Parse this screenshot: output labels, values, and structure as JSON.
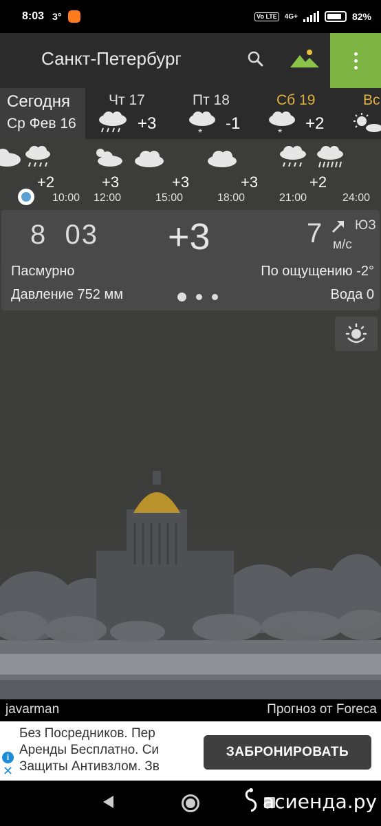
{
  "status_bar": {
    "time": "8:03",
    "temp": "3°",
    "network": "4G+",
    "volte": "Vo LTE",
    "battery": "82%"
  },
  "app_bar": {
    "city": "Санкт-Петербург"
  },
  "days": {
    "today": {
      "label": "Сегодня",
      "date": "Ср Фев 16"
    },
    "items": [
      {
        "label": "Чт 17",
        "temp": "+3",
        "icon": "rain-cloud-icon"
      },
      {
        "label": "Пт 18",
        "temp": "-1",
        "icon": "snow-cloud-icon"
      },
      {
        "label": "Сб 19",
        "temp": "+2",
        "icon": "snow-cloud-icon",
        "color": "#e0b040"
      },
      {
        "label": "Вс",
        "icon": "sun-cloud-icon"
      }
    ]
  },
  "hourly": {
    "temps": [
      "+2",
      "+3",
      "+3",
      "+3",
      "+2"
    ],
    "times": [
      "10:00",
      "12:00",
      "15:00",
      "18:00",
      "21:00",
      "24:00"
    ]
  },
  "current": {
    "time": "8  03",
    "temp": "+3",
    "wind_speed": "7",
    "wind_unit": "м/с",
    "wind_dir": "ЮЗ",
    "condition": "Пасмурно",
    "feels_like": "По ощущению -2°",
    "pressure": "Давление 752 мм",
    "water": "Вода 0"
  },
  "footer": {
    "author": "javarman",
    "credit": "Прогноз от Foreca"
  },
  "ad": {
    "lines": [
      "Без Посредников. Пер",
      "Аренды Бесплатно. Си",
      "Защиты Антивзлом. Зв"
    ],
    "button": "ЗАБРОНИРОВАТЬ"
  },
  "watermark": "асиенда.ру",
  "colors": {
    "menu_green": "#7cb342",
    "today_bg": "#3d3d3d",
    "sat_highlight": "#e0b040",
    "ad_info": "#1a8cd8"
  }
}
